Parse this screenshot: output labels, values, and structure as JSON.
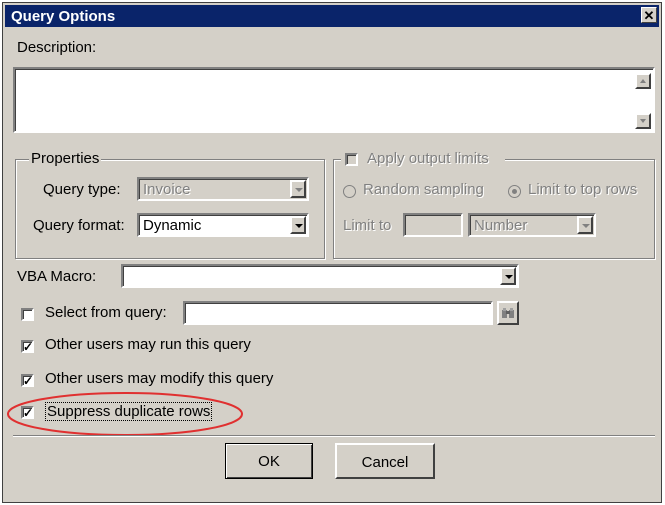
{
  "dialog": {
    "title": "Query Options",
    "close_glyph": "✕"
  },
  "description": {
    "label": "Description:",
    "value": ""
  },
  "properties": {
    "legend": "Properties",
    "query_type_label": "Query type:",
    "query_type_value": "Invoice",
    "query_format_label": "Query format:",
    "query_format_value": "Dynamic"
  },
  "output_limits": {
    "label": "Apply output limits",
    "checked": false,
    "random_sampling_label": "Random sampling",
    "limit_top_label": "Limit to top rows",
    "limit_to_label": "Limit to",
    "limit_value": "",
    "unit_value": "Number"
  },
  "vba": {
    "label": "VBA Macro:",
    "value": ""
  },
  "select_from_query": {
    "label": "Select from query:",
    "checked": false,
    "value": ""
  },
  "options": [
    {
      "label": "Other users may run this query",
      "checked": true
    },
    {
      "label": "Other users may modify this query",
      "checked": true
    },
    {
      "label": "Suppress duplicate rows",
      "checked": true
    }
  ],
  "buttons": {
    "ok": "OK",
    "cancel": "Cancel"
  },
  "colors": {
    "title_bar": "#0a246a",
    "face": "#d4d0c8",
    "highlight_ellipse": "#e03030"
  },
  "icons": {
    "browse": "binoculars-icon"
  }
}
